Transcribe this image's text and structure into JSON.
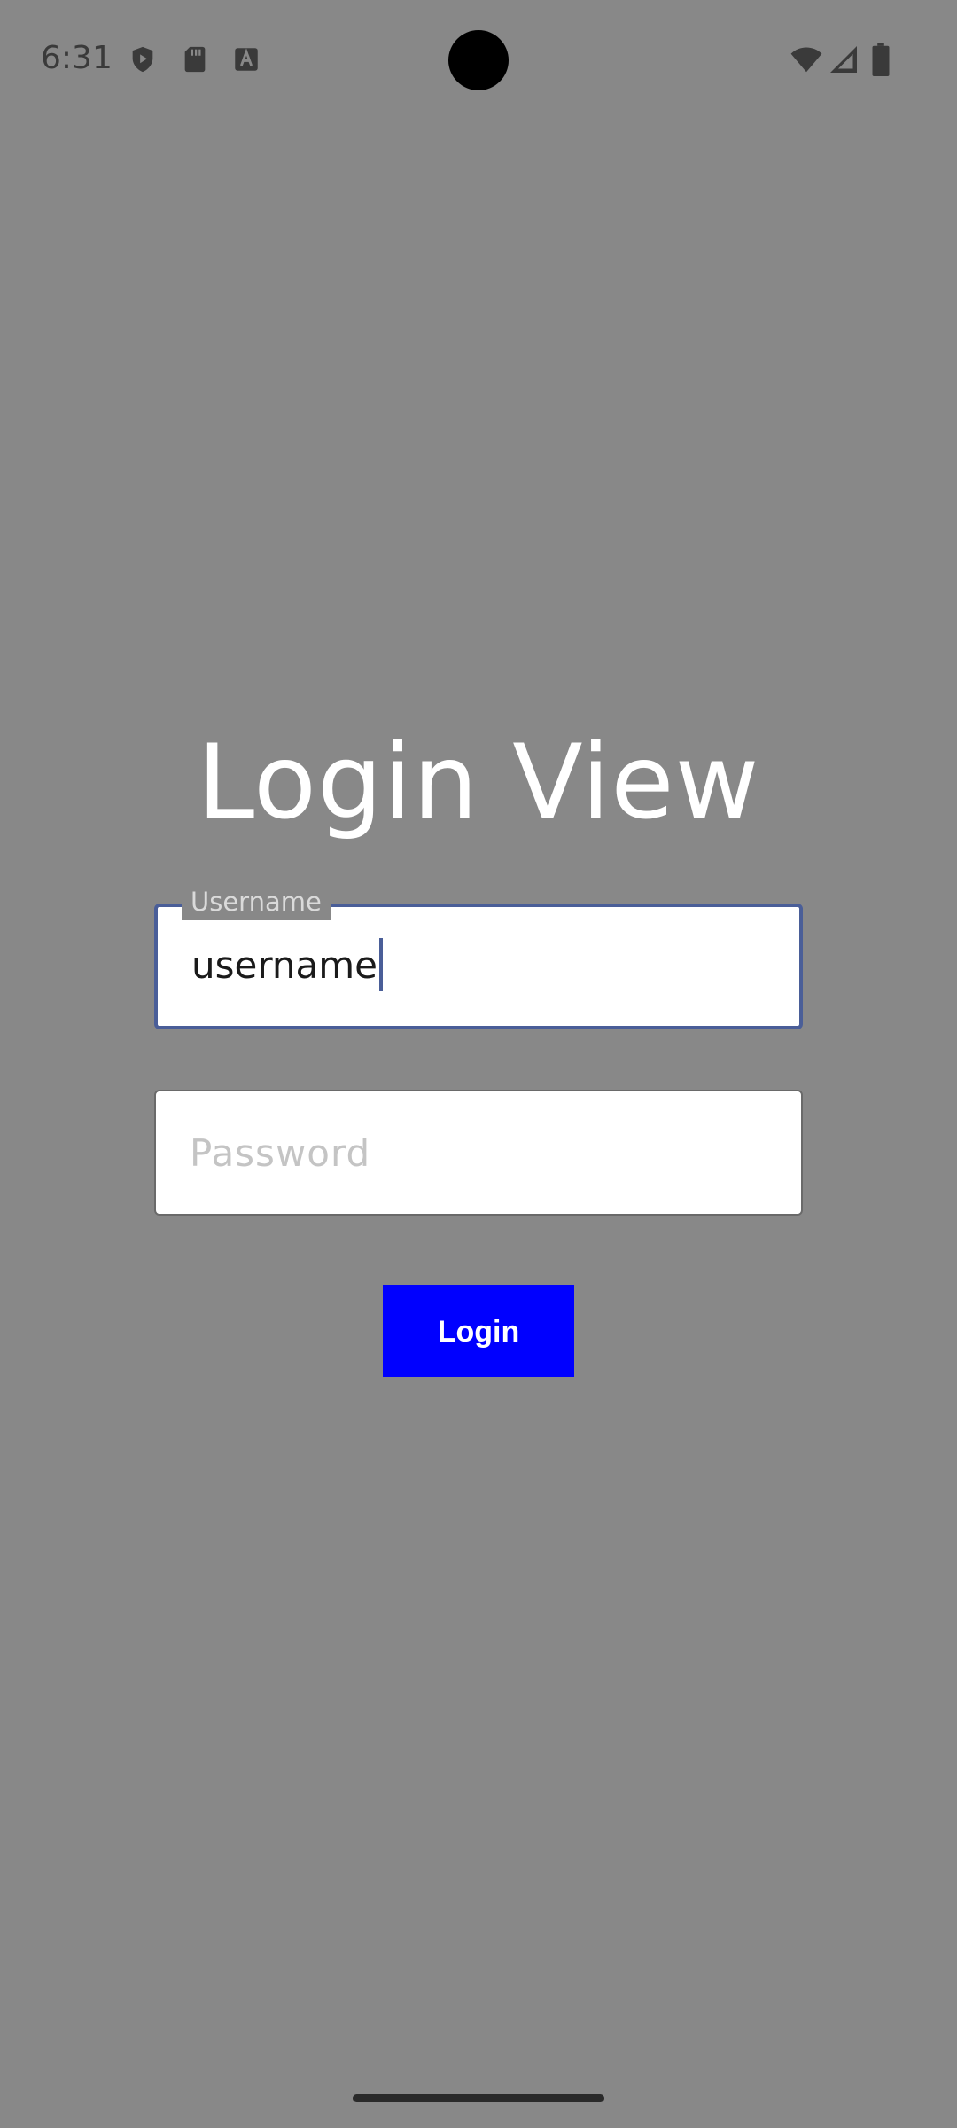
{
  "status_bar": {
    "time": "6:31",
    "left_icons": [
      "shield-play-icon",
      "sd-card-icon",
      "keyboard-a-icon"
    ],
    "right_icons": [
      "wifi-icon",
      "cell-signal-icon",
      "battery-icon"
    ]
  },
  "login": {
    "title": "Login View",
    "username": {
      "label": "Username",
      "value": "username"
    },
    "password": {
      "placeholder": "Password",
      "value": ""
    },
    "login_button_label": "Login"
  },
  "colors": {
    "background": "#888888",
    "button": "#0000ff",
    "focus_border": "#4a5e98",
    "title": "#ffffff"
  }
}
